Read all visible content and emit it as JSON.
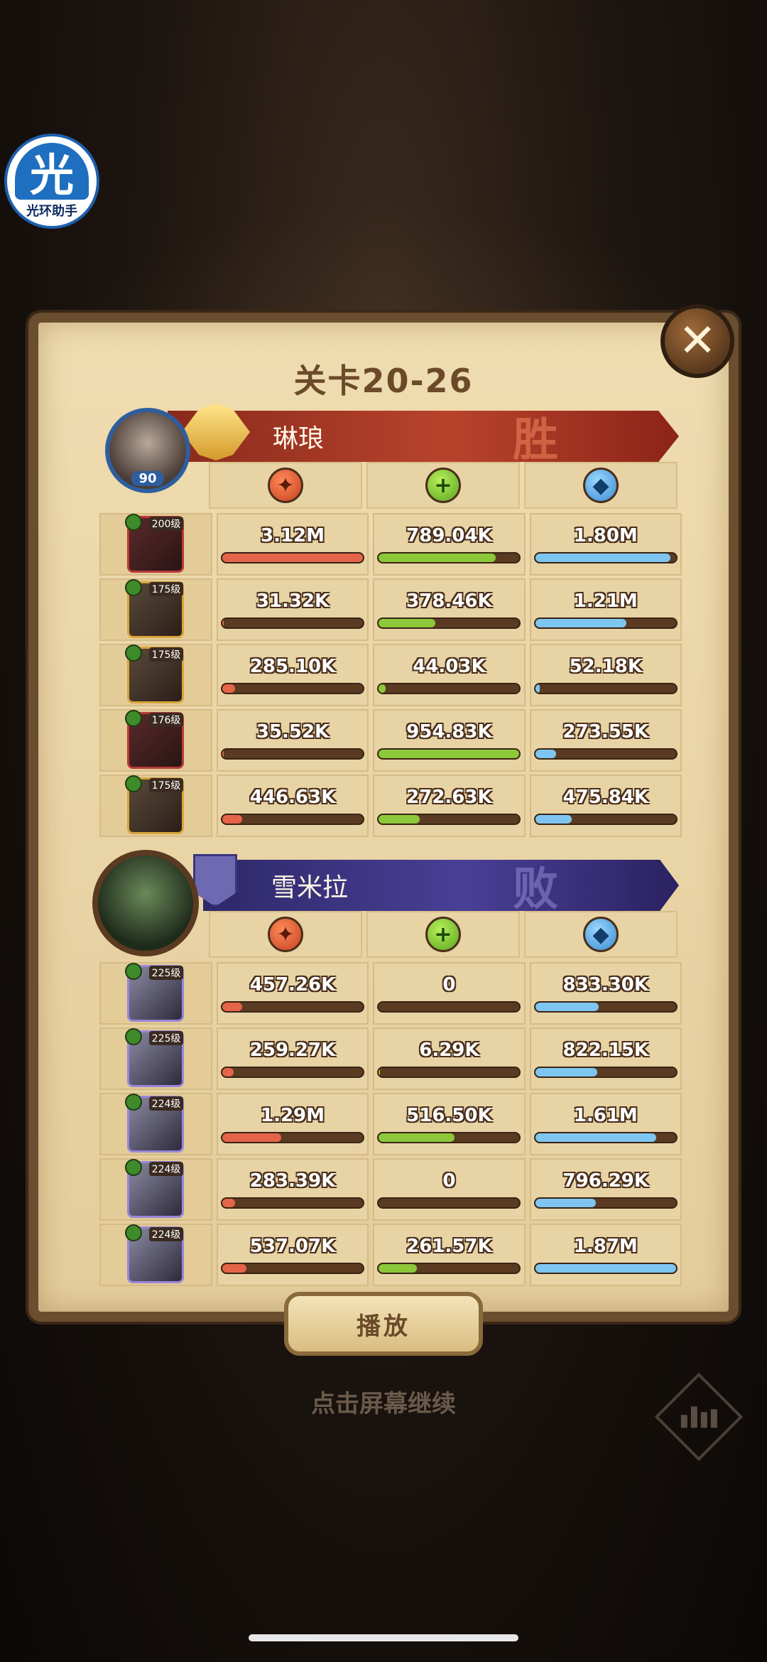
{
  "watermark": {
    "glyph": "光",
    "label": "光环助手"
  },
  "title": "关卡20-26",
  "close_glyph": "✕",
  "team_win": {
    "name": "琳琅",
    "result": "胜",
    "leader_level": "90",
    "rows": [
      {
        "level": "200级",
        "frame": "red",
        "damage": "3.12M",
        "heal": "789.04K",
        "defense": "1.80M",
        "dmg_fill": 1.0,
        "heal_fill": 0.83,
        "def_fill": 0.96
      },
      {
        "level": "175级",
        "frame": "gold",
        "damage": "31.32K",
        "heal": "378.46K",
        "defense": "1.21M",
        "dmg_fill": 0.01,
        "heal_fill": 0.4,
        "def_fill": 0.65
      },
      {
        "level": "175级",
        "frame": "gold",
        "damage": "285.10K",
        "heal": "44.03K",
        "defense": "52.18K",
        "dmg_fill": 0.09,
        "heal_fill": 0.05,
        "def_fill": 0.03
      },
      {
        "level": "176级",
        "frame": "red",
        "damage": "35.52K",
        "heal": "954.83K",
        "defense": "273.55K",
        "dmg_fill": 0.01,
        "heal_fill": 1.0,
        "def_fill": 0.15
      },
      {
        "level": "175级",
        "frame": "gold",
        "damage": "446.63K",
        "heal": "272.63K",
        "defense": "475.84K",
        "dmg_fill": 0.14,
        "heal_fill": 0.29,
        "def_fill": 0.26
      }
    ]
  },
  "team_lose": {
    "name": "雪米拉",
    "result": "败",
    "rows": [
      {
        "level": "225级",
        "frame": "purple",
        "damage": "457.26K",
        "heal": "0",
        "defense": "833.30K",
        "dmg_fill": 0.14,
        "heal_fill": 0.0,
        "def_fill": 0.45
      },
      {
        "level": "225级",
        "frame": "purple",
        "damage": "259.27K",
        "heal": "6.29K",
        "defense": "822.15K",
        "dmg_fill": 0.08,
        "heal_fill": 0.01,
        "def_fill": 0.44
      },
      {
        "level": "224级",
        "frame": "purple",
        "damage": "1.29M",
        "heal": "516.50K",
        "defense": "1.61M",
        "dmg_fill": 0.42,
        "heal_fill": 0.54,
        "def_fill": 0.86
      },
      {
        "level": "224级",
        "frame": "purple",
        "damage": "283.39K",
        "heal": "0",
        "defense": "796.29K",
        "dmg_fill": 0.09,
        "heal_fill": 0.0,
        "def_fill": 0.43
      },
      {
        "level": "224级",
        "frame": "purple",
        "damage": "537.07K",
        "heal": "261.57K",
        "defense": "1.87M",
        "dmg_fill": 0.17,
        "heal_fill": 0.27,
        "def_fill": 1.0
      }
    ]
  },
  "stat_icons": {
    "damage": "damage-icon",
    "heal": "heal-icon",
    "defense": "shield-icon"
  },
  "play_label": "播放",
  "continue_text": "点击屏幕继续"
}
